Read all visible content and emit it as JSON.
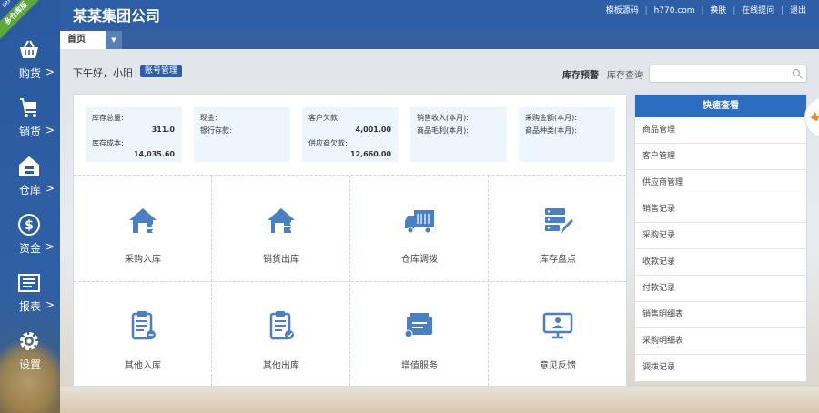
{
  "ribbon": {
    "label": "多仓库版",
    "sub": "ERP"
  },
  "sidebar": {
    "items": [
      {
        "label": "购货",
        "icon": "basket-icon"
      },
      {
        "label": "销货",
        "icon": "cart-icon"
      },
      {
        "label": "仓库",
        "icon": "warehouse-icon"
      },
      {
        "label": "资金",
        "icon": "dollar-icon"
      },
      {
        "label": "报表",
        "icon": "report-icon"
      },
      {
        "label": "设置",
        "icon": "gear-icon"
      }
    ],
    "arrow": ">"
  },
  "header": {
    "company": "某某集团公司",
    "links": [
      "模板源码",
      "h770.com",
      "换肤",
      "在线提问",
      "退出"
    ],
    "sep": "|"
  },
  "tabs": {
    "home": "首页",
    "dropdown": "▼"
  },
  "greeting": {
    "text": "下午好，小阳",
    "account_btn": "账号管理"
  },
  "stock": {
    "warn": "库存预警",
    "query": "库存查询",
    "search_placeholder": ""
  },
  "stats": [
    {
      "rows": [
        {
          "label": "库存总量:",
          "value": "311.0"
        },
        {
          "label": "库存成本:",
          "value": "14,035.60"
        }
      ]
    },
    {
      "rows": [
        {
          "label": "现金:",
          "value": ""
        },
        {
          "label": "银行存款:",
          "value": ""
        }
      ]
    },
    {
      "rows": [
        {
          "label": "客户欠款:",
          "value": "4,001.00"
        },
        {
          "label": "供应商欠款:",
          "value": "12,660.00"
        }
      ]
    },
    {
      "rows": [
        {
          "label": "销售收入(本月):",
          "value": ""
        },
        {
          "label": "商品毛利(本月):",
          "value": ""
        }
      ]
    },
    {
      "rows": [
        {
          "label": "采购金额(本月):",
          "value": ""
        },
        {
          "label": "商品种类(本月):",
          "value": ""
        }
      ]
    }
  ],
  "functions": [
    {
      "label": "采购入库",
      "icon": "purchase-in-icon"
    },
    {
      "label": "销货出库",
      "icon": "sales-out-icon"
    },
    {
      "label": "仓库调拨",
      "icon": "truck-icon"
    },
    {
      "label": "库存盘点",
      "icon": "inventory-icon"
    },
    {
      "label": "其他入库",
      "icon": "clipboard-in-icon"
    },
    {
      "label": "其他出库",
      "icon": "clipboard-out-icon"
    },
    {
      "label": "增值服务",
      "icon": "service-icon"
    },
    {
      "label": "意见反馈",
      "icon": "feedback-icon"
    }
  ],
  "quick": {
    "title": "快速查看",
    "items": [
      "商品管理",
      "客户管理",
      "供应商管理",
      "销售记录",
      "采购记录",
      "收款记录",
      "付款记录",
      "销售明细表",
      "采购明细表",
      "调拨记录"
    ]
  },
  "colors": {
    "primary": "#2d5ea6",
    "accent": "#4a7fc1",
    "light": "#edf5fd"
  }
}
